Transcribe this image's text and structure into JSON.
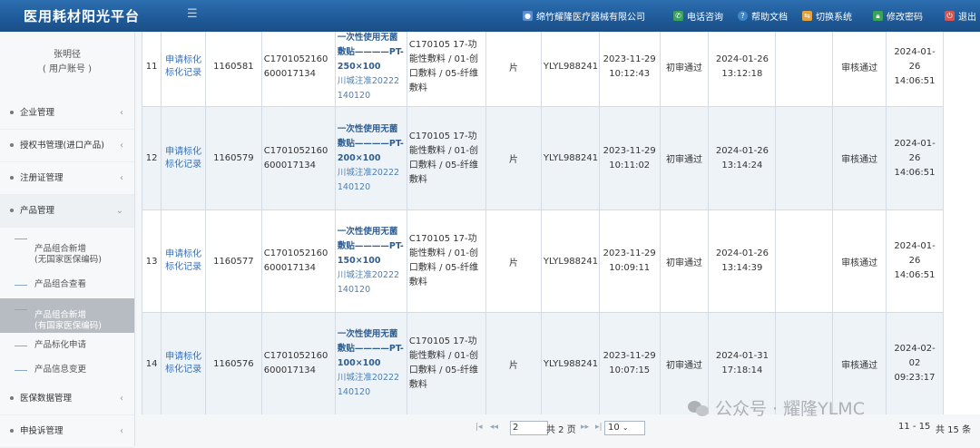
{
  "header": {
    "title": "医用耗材阳光平台",
    "menu_icon": "menu-icon",
    "company": "绵竹耀隆医疗器械有限公司",
    "phone": "电话咨询",
    "help": "帮助文档",
    "switch": "切换系统",
    "password": "修改密码",
    "logout": "退出"
  },
  "sidebar": {
    "user_name": "张明径",
    "user_role": "( 用户账号 )",
    "items": [
      {
        "label": "企业管理"
      },
      {
        "label": "授权书管理(进口产品)"
      },
      {
        "label": "注册证管理"
      },
      {
        "label": "产品管理"
      },
      {
        "label": "医保数据管理"
      },
      {
        "label": "申投诉管理"
      }
    ],
    "sub_items": [
      {
        "label": "产品组合新增\n(无国家医保编码)"
      },
      {
        "label": "产品组合查看"
      },
      {
        "label": "产品组合新增\n(有国家医保编码)"
      },
      {
        "label": "产品标化申请"
      },
      {
        "label": "产品信息变更"
      }
    ]
  },
  "table": {
    "rows": [
      {
        "no": "11",
        "action": "申请标化标化记录",
        "id": "1160581",
        "code": "C1701052160600017134",
        "name": "一次性使用无菌敷贴————PT-250×100",
        "maker": "川城注准20222140120",
        "cat": "C170105 17-功能性敷料 / 01-创口敷料 / 05-纤维敷料",
        "unit": "片",
        "yb": "YLYL988241",
        "t1": "2023-11-29 10:12:43",
        "s1": "初审通过",
        "t2": "2024-01-26 13:12:18",
        "blank": "",
        "s2": "审核通过",
        "t3": "2024-01-26 14:06:51"
      },
      {
        "no": "12",
        "action": "申请标化标化记录",
        "id": "1160579",
        "code": "C1701052160600017134",
        "name": "一次性使用无菌敷贴————PT-200×100",
        "maker": "川城注准20222140120",
        "cat": "C170105 17-功能性敷料 / 01-创口敷料 / 05-纤维敷料",
        "unit": "片",
        "yb": "YLYL988241",
        "t1": "2023-11-29 10:11:02",
        "s1": "初审通过",
        "t2": "2024-01-26 13:14:24",
        "blank": "",
        "s2": "审核通过",
        "t3": "2024-01-26 14:06:51"
      },
      {
        "no": "13",
        "action": "申请标化标化记录",
        "id": "1160577",
        "code": "C1701052160600017134",
        "name": "一次性使用无菌敷贴————PT-150×100",
        "maker": "川城注准20222140120",
        "cat": "C170105 17-功能性敷料 / 01-创口敷料 / 05-纤维敷料",
        "unit": "片",
        "yb": "YLYL988241",
        "t1": "2023-11-29 10:09:11",
        "s1": "初审通过",
        "t2": "2024-01-26 13:14:39",
        "blank": "",
        "s2": "审核通过",
        "t3": "2024-01-26 14:06:51"
      },
      {
        "no": "14",
        "action": "申请标化标化记录",
        "id": "1160576",
        "code": "C1701052160600017134",
        "name": "一次性使用无菌敷贴————PT-100×100",
        "maker": "川城注准20222140120",
        "cat": "C170105 17-功能性敷料 / 01-创口敷料 / 05-纤维敷料",
        "unit": "片",
        "yb": "YLYL988241",
        "t1": "2023-11-29 10:07:15",
        "s1": "初审通过",
        "t2": "2024-01-31 17:18:14",
        "blank": "",
        "s2": "审核通过",
        "t3": "2024-02-02 09:23:17"
      }
    ]
  },
  "pager": {
    "page_value": "2",
    "total_pages": "共 2 页",
    "page_size": "10",
    "range": "11 - 15",
    "total": "共 15 条"
  },
  "watermark": "公众号 · 耀隆YLMC"
}
